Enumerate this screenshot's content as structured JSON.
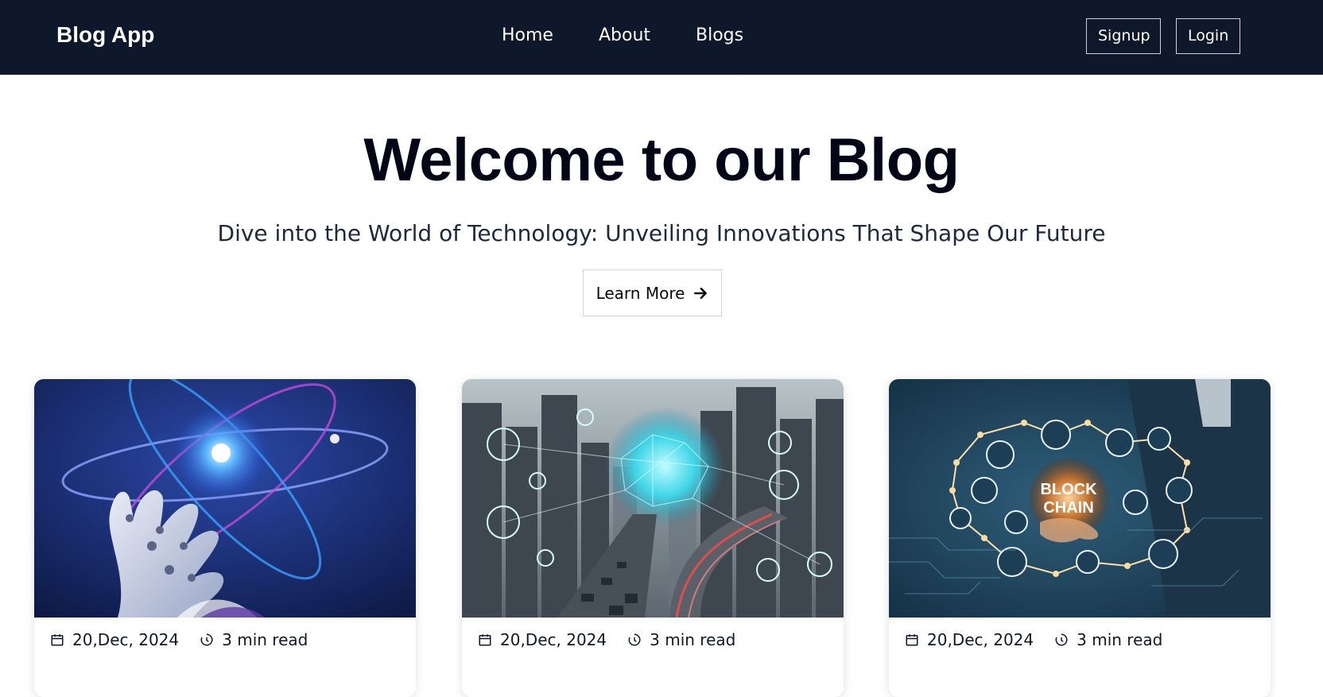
{
  "nav": {
    "brand": "Blog App",
    "links": [
      "Home",
      "About",
      "Blogs"
    ],
    "signup": "Signup",
    "login": "Login"
  },
  "hero": {
    "title": "Welcome to our Blog",
    "subtitle": "Dive into the World of Technology: Unveiling Innovations That Shape Our Future",
    "cta": "Learn More"
  },
  "cards": [
    {
      "date": "20,Dec, 2024",
      "read_time": "3 min read",
      "image": "robot-hand-atom"
    },
    {
      "date": "20,Dec, 2024",
      "read_time": "3 min read",
      "image": "smart-city-network"
    },
    {
      "date": "20,Dec, 2024",
      "read_time": "3 min read",
      "image": "blockchain-hand"
    }
  ],
  "image_text": {
    "blockchain_line1": "BLOCK",
    "blockchain_line2": "CHAIN"
  },
  "colors": {
    "navbar_bg": "#0f172a",
    "title": "#020617",
    "subtitle": "#1e293b"
  },
  "icons": {
    "date": "calendar-icon",
    "read_time": "clock-icon",
    "cta": "arrow-right-icon"
  }
}
